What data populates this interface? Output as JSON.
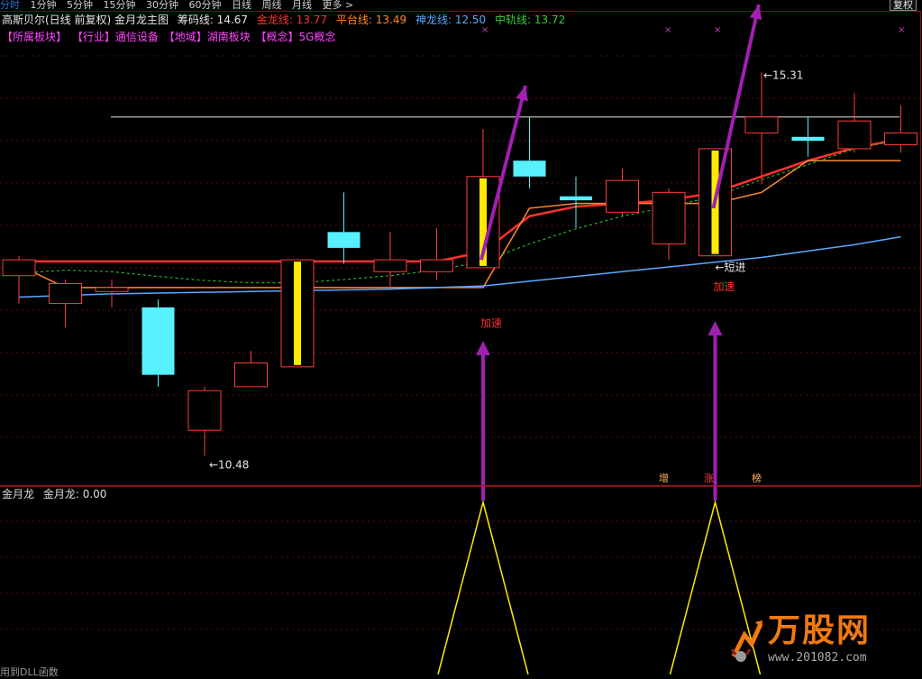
{
  "tabs": [
    "分时",
    "1分钟",
    "5分钟",
    "15分钟",
    "30分钟",
    "60分钟",
    "日线",
    "周线",
    "月线",
    "更多 >"
  ],
  "active_tab": "分时",
  "fuquan_button": "复权",
  "header": {
    "stock": "高斯贝尔(日线 前复权) 金月龙主图",
    "indicators": [
      {
        "label": "筹码线: 14.67",
        "color": "#e6e6e6"
      },
      {
        "label": "金龙线: 13.77",
        "color": "#ff3030"
      },
      {
        "label": "平台线: 13.49",
        "color": "#ff8a30"
      },
      {
        "label": "神龙线: 12.50",
        "color": "#5aa8ff"
      },
      {
        "label": "中轨线: 13.72",
        "color": "#30d030"
      }
    ]
  },
  "tags": [
    "【所属板块】",
    "【行业】通信设备",
    "【地域】湖南板块",
    "【概念】5G概念"
  ],
  "annotations": {
    "low_label": "10.48",
    "high_label": "15.31",
    "short_label": "短进",
    "accel_1": "加速",
    "accel_2": "加速",
    "bottom_marks": [
      "增",
      "涨",
      "榜"
    ]
  },
  "sub_panel": {
    "title": "金月龙",
    "value_label": "金月龙: 0.00"
  },
  "watermark": {
    "brand": "万股网",
    "url": "www.201082.com"
  },
  "footer_hint": "用到DLL函数",
  "chart_data": {
    "type": "candlestick",
    "title": "高斯贝尔(日线 前复权) 金月龙主图",
    "yrange": [
      10.2,
      15.6
    ],
    "candles": [
      {
        "o": 12.75,
        "h": 13.0,
        "l": 12.4,
        "c": 12.95
      },
      {
        "o": 12.4,
        "h": 12.7,
        "l": 12.1,
        "c": 12.65
      },
      {
        "o": 12.55,
        "h": 12.7,
        "l": 12.35,
        "c": 12.6
      },
      {
        "o": 12.35,
        "h": 12.45,
        "l": 11.35,
        "c": 11.5
      },
      {
        "o": 10.8,
        "h": 11.35,
        "l": 10.48,
        "c": 11.3
      },
      {
        "o": 11.35,
        "h": 11.8,
        "l": 11.35,
        "c": 11.65
      },
      {
        "o": 11.6,
        "h": 12.95,
        "l": 11.6,
        "c": 12.95
      },
      {
        "o": 13.3,
        "h": 13.8,
        "l": 12.9,
        "c": 13.1
      },
      {
        "o": 12.8,
        "h": 13.3,
        "l": 12.6,
        "c": 12.95
      },
      {
        "o": 12.8,
        "h": 13.35,
        "l": 12.7,
        "c": 12.95
      },
      {
        "o": 12.85,
        "h": 14.6,
        "l": 12.85,
        "c": 14.0
      },
      {
        "o": 14.2,
        "h": 14.75,
        "l": 13.85,
        "c": 14.0
      },
      {
        "o": 13.75,
        "h": 14.0,
        "l": 13.35,
        "c": 13.7
      },
      {
        "o": 13.55,
        "h": 14.1,
        "l": 13.5,
        "c": 13.95
      },
      {
        "o": 13.15,
        "h": 13.85,
        "l": 12.95,
        "c": 13.8
      },
      {
        "o": 13.0,
        "h": 14.35,
        "l": 13.0,
        "c": 14.35
      },
      {
        "o": 14.55,
        "h": 15.31,
        "l": 13.9,
        "c": 14.75
      },
      {
        "o": 14.5,
        "h": 14.75,
        "l": 14.25,
        "c": 14.45
      },
      {
        "o": 14.35,
        "h": 15.05,
        "l": 14.3,
        "c": 14.7
      },
      {
        "o": 14.4,
        "h": 14.9,
        "l": 14.3,
        "c": 14.55
      }
    ],
    "series": [
      {
        "name": "金龙线",
        "color": "#ff3030",
        "values": [
          12.93,
          12.93,
          12.93,
          12.93,
          12.93,
          12.93,
          12.93,
          12.93,
          12.93,
          12.93,
          13.05,
          13.5,
          13.62,
          13.66,
          13.7,
          13.8,
          14.0,
          14.2,
          14.36,
          14.47
        ]
      },
      {
        "name": "平台线",
        "color": "#ff8a30",
        "values": [
          12.88,
          12.6,
          12.6,
          12.6,
          12.6,
          12.6,
          12.6,
          12.6,
          12.6,
          12.6,
          12.6,
          13.6,
          13.66,
          13.66,
          13.66,
          13.66,
          13.8,
          14.2,
          14.2,
          14.2
        ]
      },
      {
        "name": "神龙线",
        "color": "#5aa8ff",
        "values": [
          12.48,
          12.5,
          12.52,
          12.53,
          12.54,
          12.55,
          12.56,
          12.57,
          12.58,
          12.6,
          12.62,
          12.68,
          12.74,
          12.8,
          12.86,
          12.92,
          12.98,
          13.06,
          13.14,
          13.24
        ]
      },
      {
        "name": "中轨线",
        "color": "#30d030",
        "values": [
          12.78,
          12.82,
          12.8,
          12.74,
          12.69,
          12.66,
          12.66,
          12.7,
          12.75,
          12.82,
          12.93,
          13.15,
          13.34,
          13.5,
          13.62,
          13.75,
          13.96,
          14.15,
          14.35,
          14.47
        ]
      }
    ]
  }
}
